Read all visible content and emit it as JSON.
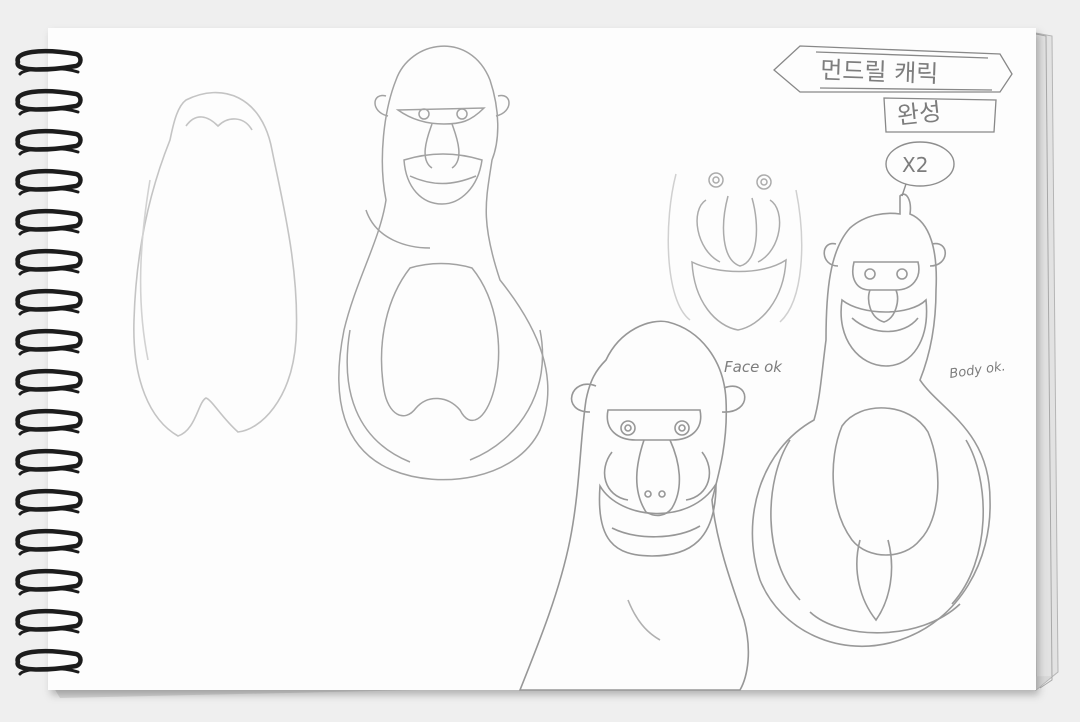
{
  "annotations": {
    "title_korean_line1": "먼드릴 캐릭",
    "title_korean_line2": "완성",
    "circled_mark": "X2",
    "face_note": "Face ok",
    "body_note": "Body ok."
  },
  "colors": {
    "background": "#efefef",
    "paper": "#fdfdfd",
    "pencil": "#9a9a9a",
    "pencil_light": "#c4c4c4",
    "spiral": "#1c1c1c"
  }
}
